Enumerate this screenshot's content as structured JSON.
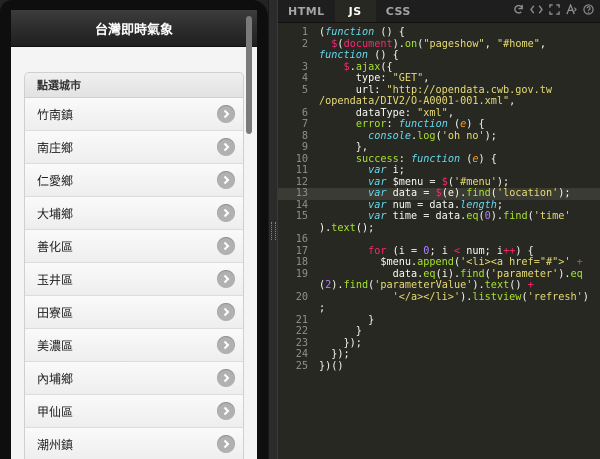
{
  "preview": {
    "header_title": "台灣即時氣象",
    "list_divider": "點選城市",
    "items": [
      "竹南鎮",
      "南庄鄉",
      "仁愛鄉",
      "大埔鄉",
      "善化區",
      "玉井區",
      "田寮區",
      "美濃區",
      "內埔鄉",
      "甲仙區",
      "潮州鎮"
    ]
  },
  "editor": {
    "tabs": [
      "HTML",
      "JS",
      "CSS"
    ],
    "active_tab": "JS",
    "tools": [
      "refresh-icon",
      "code-icon",
      "expand-icon",
      "format-icon",
      "help-icon"
    ],
    "lines": [
      {
        "num": "1",
        "tokens": [
          [
            "",
            "("
          ],
          [
            "f",
            "function"
          ],
          [
            "",
            " () {"
          ]
        ]
      },
      {
        "num": "2",
        "tokens": [
          [
            "",
            "  "
          ],
          [
            "k",
            "$"
          ],
          [
            "",
            "("
          ],
          [
            "k",
            "document"
          ],
          [
            "",
            ")."
          ],
          [
            "g",
            "on"
          ],
          [
            "",
            "("
          ],
          [
            "s",
            "\"pageshow\""
          ],
          [
            "",
            ", "
          ],
          [
            "s",
            "\"#home\""
          ],
          [
            "",
            ","
          ]
        ]
      },
      {
        "num": "",
        "tokens": [
          [
            "f",
            "function"
          ],
          [
            "",
            " () {"
          ]
        ]
      },
      {
        "num": "3",
        "tokens": [
          [
            "",
            "    "
          ],
          [
            "k",
            "$"
          ],
          [
            "",
            "."
          ],
          [
            "g",
            "ajax"
          ],
          [
            "",
            "({"
          ]
        ]
      },
      {
        "num": "4",
        "tokens": [
          [
            "",
            "      type: "
          ],
          [
            "s",
            "\"GET\""
          ],
          [
            "",
            ","
          ]
        ]
      },
      {
        "num": "5",
        "tokens": [
          [
            "",
            "      url: "
          ],
          [
            "s",
            "\"http://opendata.cwb.gov.tw"
          ]
        ]
      },
      {
        "num": "",
        "tokens": [
          [
            "s",
            "/opendata/DIV2/O-A0001-001.xml\""
          ],
          [
            "",
            ","
          ]
        ]
      },
      {
        "num": "6",
        "tokens": [
          [
            "",
            "      dataType: "
          ],
          [
            "s",
            "\"xml\""
          ],
          [
            "",
            ","
          ]
        ]
      },
      {
        "num": "7",
        "tokens": [
          [
            "",
            "      "
          ],
          [
            "g",
            "error"
          ],
          [
            "",
            ": "
          ],
          [
            "f",
            "function"
          ],
          [
            "",
            " ("
          ],
          [
            "p",
            "e"
          ],
          [
            "",
            ") {"
          ]
        ]
      },
      {
        "num": "8",
        "tokens": [
          [
            "",
            "        "
          ],
          [
            "c",
            "console"
          ],
          [
            "",
            "."
          ],
          [
            "g",
            "log"
          ],
          [
            "",
            "("
          ],
          [
            "s",
            "'oh no'"
          ],
          [
            "",
            ");"
          ]
        ]
      },
      {
        "num": "9",
        "tokens": [
          [
            "",
            "      },"
          ]
        ]
      },
      {
        "num": "10",
        "tokens": [
          [
            "",
            "      "
          ],
          [
            "g",
            "success"
          ],
          [
            "",
            ": "
          ],
          [
            "f",
            "function"
          ],
          [
            "",
            " ("
          ],
          [
            "p",
            "e"
          ],
          [
            "",
            ") {"
          ]
        ]
      },
      {
        "num": "11",
        "tokens": [
          [
            "",
            "        "
          ],
          [
            "f",
            "var"
          ],
          [
            "",
            " i;"
          ]
        ]
      },
      {
        "num": "12",
        "tokens": [
          [
            "",
            "        "
          ],
          [
            "f",
            "var"
          ],
          [
            "",
            " $menu = "
          ],
          [
            "k",
            "$"
          ],
          [
            "",
            "("
          ],
          [
            "s",
            "'#menu'"
          ],
          [
            "",
            ");"
          ]
        ]
      },
      {
        "num": "13",
        "tokens": [
          [
            "",
            "        "
          ],
          [
            "f",
            "var"
          ],
          [
            "",
            " data = "
          ],
          [
            "k",
            "$"
          ],
          [
            "",
            "(e)."
          ],
          [
            "g",
            "find"
          ],
          [
            "",
            "("
          ],
          [
            "s",
            "'location'"
          ],
          [
            "",
            ");"
          ]
        ]
      },
      {
        "num": "14",
        "tokens": [
          [
            "",
            "        "
          ],
          [
            "f",
            "var"
          ],
          [
            "",
            " num = data."
          ],
          [
            "c",
            "length"
          ],
          [
            "",
            ";"
          ]
        ]
      },
      {
        "num": "15",
        "tokens": [
          [
            "",
            "        "
          ],
          [
            "f",
            "var"
          ],
          [
            "",
            " time = data."
          ],
          [
            "g",
            "eq"
          ],
          [
            "",
            "("
          ],
          [
            "n",
            "0"
          ],
          [
            "",
            ")."
          ],
          [
            "g",
            "find"
          ],
          [
            "",
            "("
          ],
          [
            "s",
            "'time'"
          ]
        ]
      },
      {
        "num": "",
        "tokens": [
          [
            "",
            ")."
          ],
          [
            "g",
            "text"
          ],
          [
            "",
            "();"
          ]
        ]
      },
      {
        "num": "16",
        "tokens": [
          [
            "",
            ""
          ]
        ]
      },
      {
        "num": "17",
        "tokens": [
          [
            "",
            "        "
          ],
          [
            "k",
            "for"
          ],
          [
            "",
            " (i = "
          ],
          [
            "n",
            "0"
          ],
          [
            "",
            "; i "
          ],
          [
            "k",
            "<"
          ],
          [
            "",
            " num; i"
          ],
          [
            "k",
            "++"
          ],
          [
            "",
            ") {"
          ]
        ]
      },
      {
        "num": "18",
        "tokens": [
          [
            "",
            "          $menu."
          ],
          [
            "g",
            "append"
          ],
          [
            "",
            "("
          ],
          [
            "s",
            "'<li><a href=\"#\">'"
          ],
          [
            "",
            " "
          ],
          [
            "k",
            "+"
          ]
        ]
      },
      {
        "num": "19",
        "tokens": [
          [
            "",
            "            data."
          ],
          [
            "g",
            "eq"
          ],
          [
            "",
            "(i)."
          ],
          [
            "g",
            "find"
          ],
          [
            "",
            "("
          ],
          [
            "s",
            "'parameter'"
          ],
          [
            "",
            ")."
          ],
          [
            "g",
            "eq"
          ]
        ]
      },
      {
        "num": "",
        "tokens": [
          [
            "",
            "("
          ],
          [
            "n",
            "2"
          ],
          [
            "",
            ")."
          ],
          [
            "g",
            "find"
          ],
          [
            "",
            "("
          ],
          [
            "s",
            "'parameterValue'"
          ],
          [
            "",
            ")."
          ],
          [
            "g",
            "text"
          ],
          [
            "",
            "() "
          ],
          [
            "k",
            "+"
          ]
        ]
      },
      {
        "num": "20",
        "tokens": [
          [
            "",
            "            "
          ],
          [
            "s",
            "'</a></li>'"
          ],
          [
            "",
            ")."
          ],
          [
            "g",
            "listview"
          ],
          [
            "",
            "("
          ],
          [
            "s",
            "'refresh'"
          ],
          [
            "",
            ")"
          ]
        ]
      },
      {
        "num": "",
        "tokens": [
          [
            "",
            ";"
          ]
        ]
      },
      {
        "num": "21",
        "tokens": [
          [
            "",
            "        }"
          ]
        ]
      },
      {
        "num": "22",
        "tokens": [
          [
            "",
            "      }"
          ]
        ]
      },
      {
        "num": "23",
        "tokens": [
          [
            "",
            "    });"
          ]
        ]
      },
      {
        "num": "24",
        "tokens": [
          [
            "",
            "  });"
          ]
        ]
      },
      {
        "num": "25",
        "tokens": [
          [
            "",
            "})()"
          ]
        ]
      }
    ],
    "highlight_line": "13"
  }
}
